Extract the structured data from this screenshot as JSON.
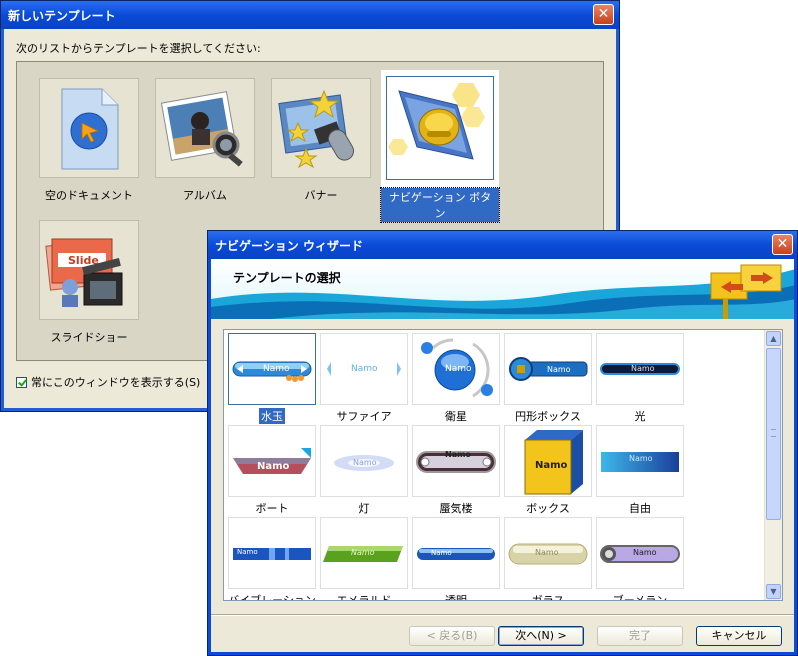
{
  "window1": {
    "title": "新しいテンプレート",
    "instruction": "次のリストからテンプレートを選択してください:",
    "templates": [
      {
        "label": "空のドキュメント"
      },
      {
        "label": "アルバム"
      },
      {
        "label": "バナー"
      },
      {
        "label": "ナビゲーション ボタン",
        "selected": true
      },
      {
        "label": "スライドショー"
      }
    ],
    "checkbox_label": "常にこのウィンドウを表示する(S)",
    "checkbox_checked": true,
    "slide_icon_text": "Slide"
  },
  "window2": {
    "title": "ナビゲーション ウィザード",
    "banner_title": "テンプレートの選択",
    "sample_text": "Namo",
    "items": [
      {
        "label": "水玉",
        "selected": true
      },
      {
        "label": "サファイア"
      },
      {
        "label": "衛星"
      },
      {
        "label": "円形ボックス"
      },
      {
        "label": "光"
      },
      {
        "label": "ボート"
      },
      {
        "label": "灯"
      },
      {
        "label": "蜃気楼"
      },
      {
        "label": "ボックス"
      },
      {
        "label": "自由"
      },
      {
        "label": "バイブレーション"
      },
      {
        "label": "エメラルド"
      },
      {
        "label": "透明"
      },
      {
        "label": "ガラス"
      },
      {
        "label": "ブーメラン"
      }
    ],
    "buttons": {
      "back": "< 戻る(B)",
      "next": "次へ(N) >",
      "finish": "完了",
      "cancel": "キャンセル"
    }
  },
  "colors": {
    "titlebar": "#0b4bd8",
    "selection": "#316ac5",
    "dialog_bg": "#ece9d8"
  }
}
